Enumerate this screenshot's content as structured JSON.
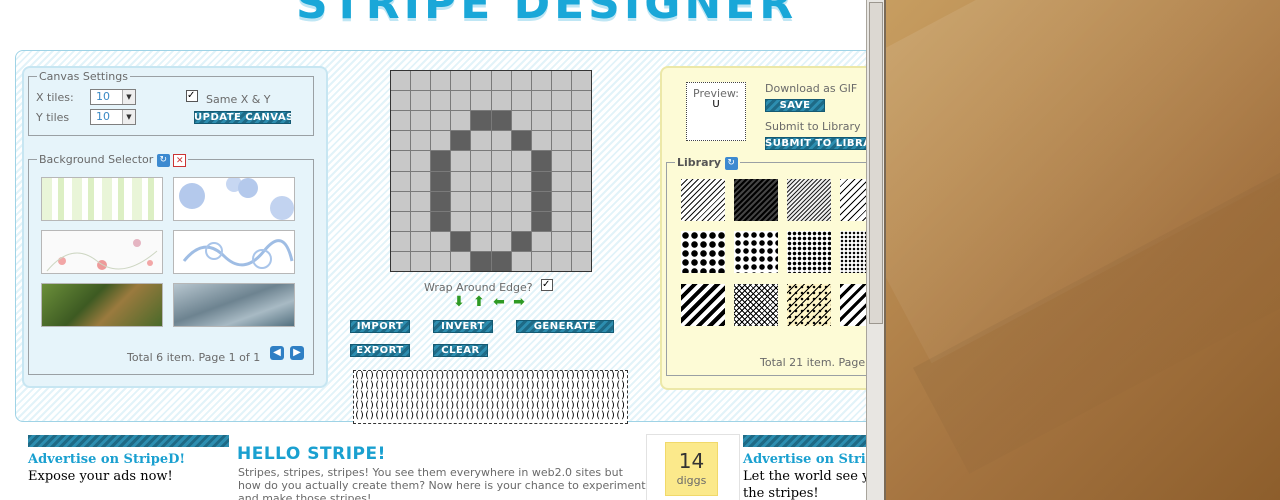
{
  "header": {
    "title": "STRIPE DESIGNER"
  },
  "canvas_settings": {
    "legend": "Canvas Settings",
    "x_label": "X tiles:",
    "x_value": "10",
    "y_label": "Y tiles",
    "y_value": "10",
    "same_xy_label": "Same X & Y",
    "same_xy_checked": true,
    "update_button": "UPDATE CANVAS"
  },
  "background_selector": {
    "legend": "Background Selector",
    "total_text": "Total 6 item. Page 1 of 1",
    "items": [
      "green-stripes",
      "blue-circles",
      "floral-pink",
      "blue-lace",
      "photo-foliage",
      "photo-steel"
    ]
  },
  "editor": {
    "grid": [
      [
        0,
        0,
        0,
        0,
        0,
        0,
        0,
        0,
        0,
        0
      ],
      [
        0,
        0,
        0,
        0,
        0,
        0,
        0,
        0,
        0,
        0
      ],
      [
        0,
        0,
        0,
        0,
        1,
        1,
        0,
        0,
        0,
        0
      ],
      [
        0,
        0,
        0,
        1,
        0,
        0,
        1,
        0,
        0,
        0
      ],
      [
        0,
        0,
        1,
        0,
        0,
        0,
        0,
        1,
        0,
        0
      ],
      [
        0,
        0,
        1,
        0,
        0,
        0,
        0,
        1,
        0,
        0
      ],
      [
        0,
        0,
        1,
        0,
        0,
        0,
        0,
        1,
        0,
        0
      ],
      [
        0,
        0,
        1,
        0,
        0,
        0,
        0,
        1,
        0,
        0
      ],
      [
        0,
        0,
        0,
        1,
        0,
        0,
        1,
        0,
        0,
        0
      ],
      [
        0,
        0,
        0,
        0,
        1,
        1,
        0,
        0,
        0,
        0
      ]
    ],
    "wrap_label": "Wrap Around Edge?",
    "wrap_checked": true,
    "buttons": {
      "import": "IMPORT",
      "invert": "INVERT",
      "generate": "GENERATE",
      "export": "EXPORT",
      "clear": "CLEAR"
    },
    "preview_glyph": "()"
  },
  "right_panel": {
    "preview_label": "Preview:",
    "preview_char": "U",
    "download_label": "Download as GIF",
    "save_button": "SAVE",
    "submit_label": "Submit to Library",
    "submit_button": "SUBMIT TO LIBRARY",
    "library_legend": "Library",
    "total_text": "Total 21 item. Page"
  },
  "footer": {
    "ad_left_title": "Advertise on StripeD!",
    "ad_left_text": "Expose your ads now!",
    "hello_title": "HELLO STRIPE!",
    "hello_text": "Stripes, stripes, stripes! You see them everywhere in web2.0 sites but how do you actually create them? Now here is your chance to experiment and make those stripes!",
    "digg_count": "14",
    "digg_label": "diggs",
    "ad_right_title": "Advertise on StripeD!",
    "ad_right_text1": "Let the world see your",
    "ad_right_text2": "the stripes!"
  },
  "colors": {
    "accent": "#1aa7d8",
    "button": "#2d8eb0",
    "panel_yellow": "#fdfbd6",
    "panel_blue": "#e6f4fa"
  }
}
